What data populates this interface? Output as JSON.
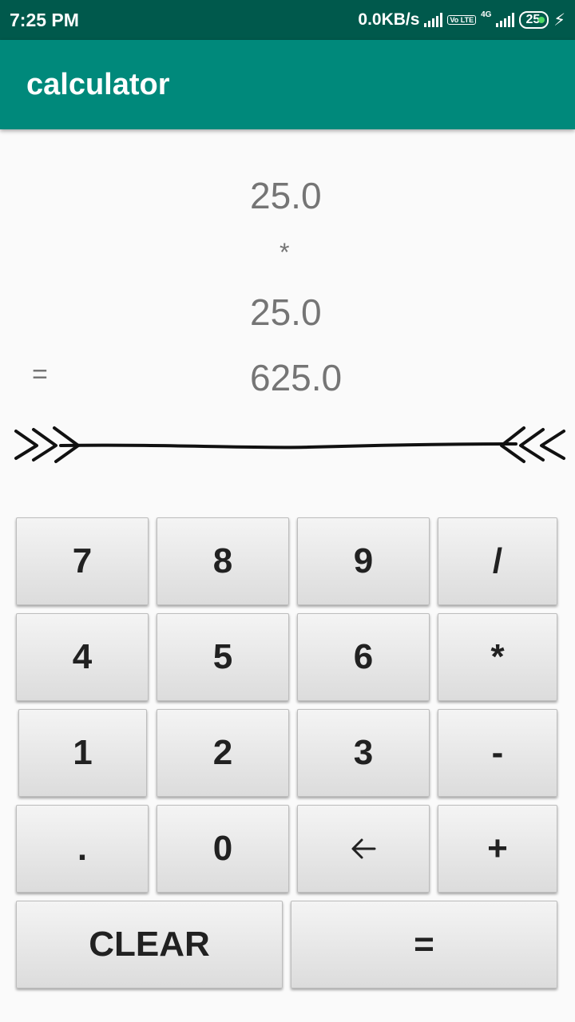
{
  "status_bar": {
    "time": "7:25 PM",
    "speed": "0.0KB/s",
    "volte_label": "Vo LTE",
    "network_label": "4G",
    "battery": "25"
  },
  "app_bar": {
    "title": "calculator"
  },
  "display": {
    "first_number": "25.0",
    "operator": "*",
    "second_number": "25.0",
    "equals_sign": "=",
    "result": "625.0"
  },
  "keypad": {
    "rows": [
      [
        "7",
        "8",
        "9",
        "/"
      ],
      [
        "4",
        "5",
        "6",
        "*"
      ],
      [
        "1",
        "2",
        "3",
        "-"
      ],
      [
        ".",
        "0",
        "backspace-icon",
        "+"
      ]
    ],
    "clear_label": "CLEAR",
    "equals_label": "="
  }
}
